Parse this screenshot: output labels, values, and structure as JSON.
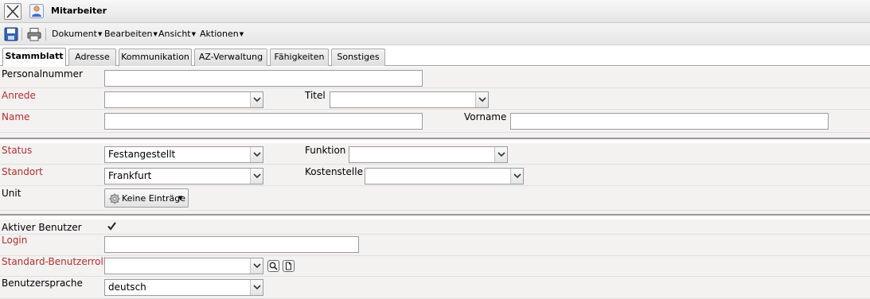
{
  "window": {
    "title": "Mitarbeiter"
  },
  "toolbar": {
    "menus": [
      "Dokument",
      "Bearbeiten",
      "Ansicht",
      "Aktionen"
    ]
  },
  "tabs": [
    "Stammblatt",
    "Adresse",
    "Kommunikation",
    "AZ-Verwaltung",
    "Fähigkeiten",
    "Sonstiges"
  ],
  "active_tab": "Stammblatt",
  "form": {
    "personalnummer": {
      "label": "Personalnummer",
      "value": ""
    },
    "anrede": {
      "label": "Anrede",
      "value": ""
    },
    "titel": {
      "label": "Titel",
      "value": ""
    },
    "name": {
      "label": "Name",
      "value": ""
    },
    "vorname": {
      "label": "Vorname",
      "value": ""
    },
    "status": {
      "label": "Status",
      "value": "Festangestellt"
    },
    "funktion": {
      "label": "Funktion",
      "value": ""
    },
    "standort": {
      "label": "Standort",
      "value": "Frankfurt"
    },
    "kostenstelle": {
      "label": "Kostenstelle",
      "value": ""
    },
    "unit": {
      "label": "Unit",
      "button": "Keine Einträge"
    },
    "aktiver_benutzer": {
      "label": "Aktiver Benutzer",
      "checked": true
    },
    "login": {
      "label": "Login",
      "value": ""
    },
    "benutzerrolle": {
      "label": "Standard-Benutzerrolle",
      "value": ""
    },
    "sprache": {
      "label": "Benutzersprache",
      "value": "deutsch"
    }
  },
  "colors": {
    "required_label": "#b03030",
    "row_bg": "#f4f1f1"
  }
}
